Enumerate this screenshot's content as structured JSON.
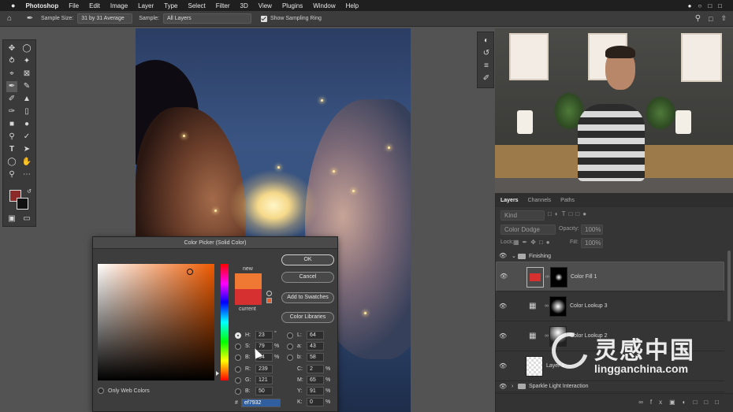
{
  "menubar": {
    "apple": "",
    "app": "Photoshop",
    "items": [
      "File",
      "Edit",
      "Image",
      "Layer",
      "Type",
      "Select",
      "Filter",
      "3D",
      "View",
      "Plugins",
      "Window",
      "Help"
    ]
  },
  "options": {
    "sample_size_label": "Sample Size:",
    "sample_size_value": "31 by 31 Average",
    "sample_label": "Sample:",
    "sample_value": "All Layers",
    "sampling_ring_label": "Show Sampling Ring"
  },
  "dialog": {
    "title": "Color Picker (Solid Color)",
    "new_label": "new",
    "current_label": "current",
    "ok": "OK",
    "cancel": "Cancel",
    "add_swatches": "Add to Swatches",
    "color_libraries": "Color Libraries",
    "only_web": "Only Web Colors",
    "H": "23",
    "H_unit": "°",
    "S": "79",
    "S_unit": "%",
    "B": "94",
    "B_unit": "%",
    "R": "239",
    "G": "121",
    "Bv": "50",
    "L": "64",
    "a": "43",
    "b": "58",
    "C": "2",
    "M": "65",
    "Y": "91",
    "K": "0",
    "pct": "%",
    "hex_label": "#",
    "hex": "ef7932",
    "colors": {
      "new": "#ef7932",
      "current": "#d73030",
      "gradient_hue": "#ef5a00"
    }
  },
  "layers": {
    "tabs": [
      "Layers",
      "Channels",
      "Paths"
    ],
    "kind": "Kind",
    "blend": "Color Dodge",
    "opacity_label": "Opacity:",
    "opacity_value": "100%",
    "lock_label": "Lock:",
    "fill_label": "Fill:",
    "fill_value": "100%",
    "items": [
      {
        "name": "Finishing"
      },
      {
        "name": "Color Fill 1"
      },
      {
        "name": "Color Lookup 3"
      },
      {
        "name": "Color Lookup 2"
      },
      {
        "name": "Layer 1"
      },
      {
        "name": "Sparkle Light Interaction"
      }
    ]
  },
  "watermark": {
    "cn": "灵感中国",
    "url": "lingganchina.com"
  }
}
